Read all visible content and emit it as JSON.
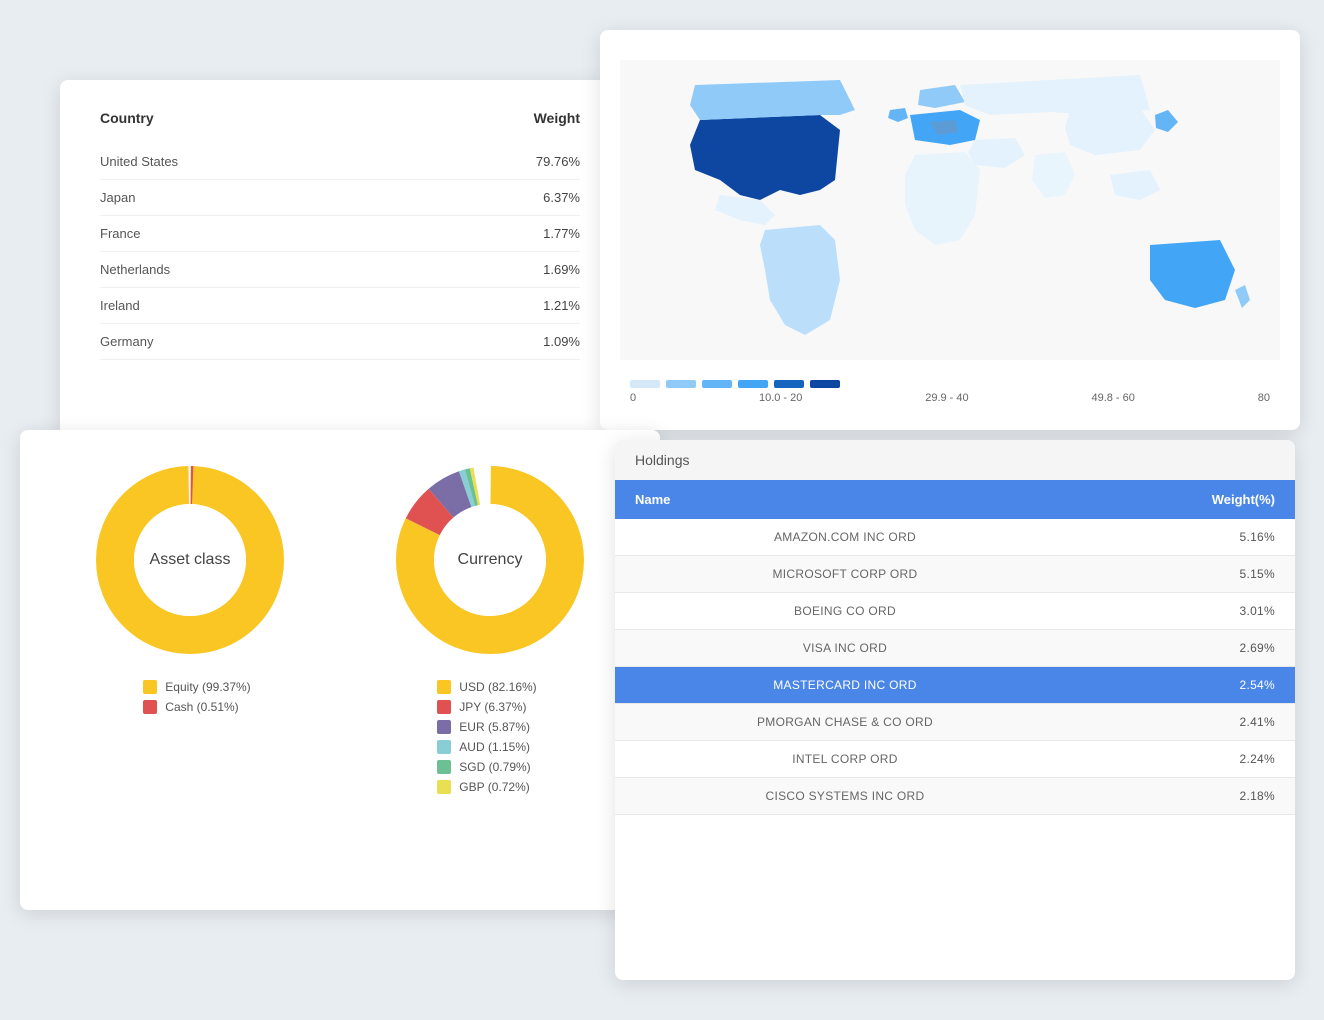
{
  "countryCard": {
    "col1": "Country",
    "col2": "Weight",
    "rows": [
      {
        "country": "United States",
        "weight": "79.76%"
      },
      {
        "country": "Japan",
        "weight": "6.37%"
      },
      {
        "country": "France",
        "weight": "1.77%"
      },
      {
        "country": "Netherlands",
        "weight": "1.69%"
      },
      {
        "country": "Ireland",
        "weight": "1.21%"
      },
      {
        "country": "Germany",
        "weight": "1.09%"
      }
    ]
  },
  "mapCard": {
    "legendLabels": [
      "0",
      "10.0 - 20",
      "29.9 - 40",
      "49.8 - 60",
      "80"
    ]
  },
  "assetCard": {
    "assetLabel": "Asset class",
    "currencyLabel": "Currency",
    "assetLegend": [
      {
        "color": "#F9C623",
        "label": "Equity (99.37%)"
      },
      {
        "color": "#E05252",
        "label": "Cash (0.51%)"
      }
    ],
    "currencyLegend": [
      {
        "color": "#F9C623",
        "label": "USD (82.16%)"
      },
      {
        "color": "#E05252",
        "label": "JPY (6.37%)"
      },
      {
        "color": "#7B6EA6",
        "label": "EUR (5.87%)"
      },
      {
        "color": "#89CED4",
        "label": "AUD (1.15%)"
      },
      {
        "color": "#6DBF94",
        "label": "SGD (0.79%)"
      },
      {
        "color": "#E8E052",
        "label": "GBP (0.72%)"
      }
    ]
  },
  "holdingsCard": {
    "sectionTitle": "Holdings",
    "col1": "Name",
    "col2": "Weight(%)",
    "rows": [
      {
        "name": "AMAZON.COM INC ORD",
        "weight": "5.16%",
        "highlight": false
      },
      {
        "name": "MICROSOFT CORP ORD",
        "weight": "5.15%",
        "highlight": false
      },
      {
        "name": "BOEING CO ORD",
        "weight": "3.01%",
        "highlight": false
      },
      {
        "name": "VISA INC ORD",
        "weight": "2.69%",
        "highlight": false
      },
      {
        "name": "MASTERCARD INC ORD",
        "weight": "2.54%",
        "highlight": true
      },
      {
        "name": "PMORGAN CHASE & CO ORD",
        "weight": "2.41%",
        "highlight": false
      },
      {
        "name": "INTEL CORP ORD",
        "weight": "2.24%",
        "highlight": false
      },
      {
        "name": "CISCO SYSTEMS INC ORD",
        "weight": "2.18%",
        "highlight": false
      }
    ]
  }
}
